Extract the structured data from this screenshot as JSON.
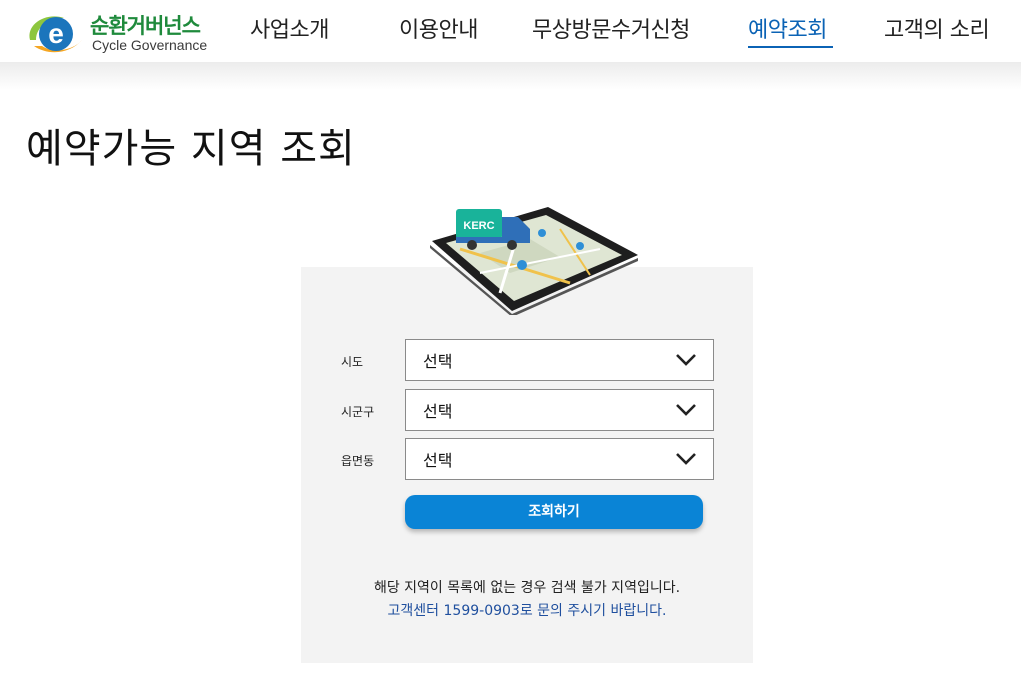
{
  "header": {
    "logo_title": "순환거버넌스",
    "logo_sub": "Cycle Governance",
    "nav": [
      {
        "label": "사업소개"
      },
      {
        "label": "이용안내"
      },
      {
        "label": "무상방문수거신청"
      },
      {
        "label": "예약조회"
      },
      {
        "label": "고객의 소리"
      }
    ],
    "active_nav": "예약조회"
  },
  "page": {
    "title": "예약가능 지역 조회"
  },
  "illustration": {
    "truck_label": "KERC"
  },
  "form": {
    "fields": [
      {
        "label": "시도",
        "value": "선택"
      },
      {
        "label": "시군구",
        "value": "선택"
      },
      {
        "label": "읍면동",
        "value": "선택"
      }
    ],
    "submit_label": "조회하기"
  },
  "notice": {
    "line1": "해당 지역이 목록에 없는 경우 검색 불가 지역입니다.",
    "line2": "고객센터 1599-0903로 문의 주시기 바랍니다."
  },
  "colors": {
    "accent": "#0b63b5",
    "button": "#0a84d6",
    "brand_green": "#1f8a3c",
    "panel_bg": "#f3f3f3"
  }
}
